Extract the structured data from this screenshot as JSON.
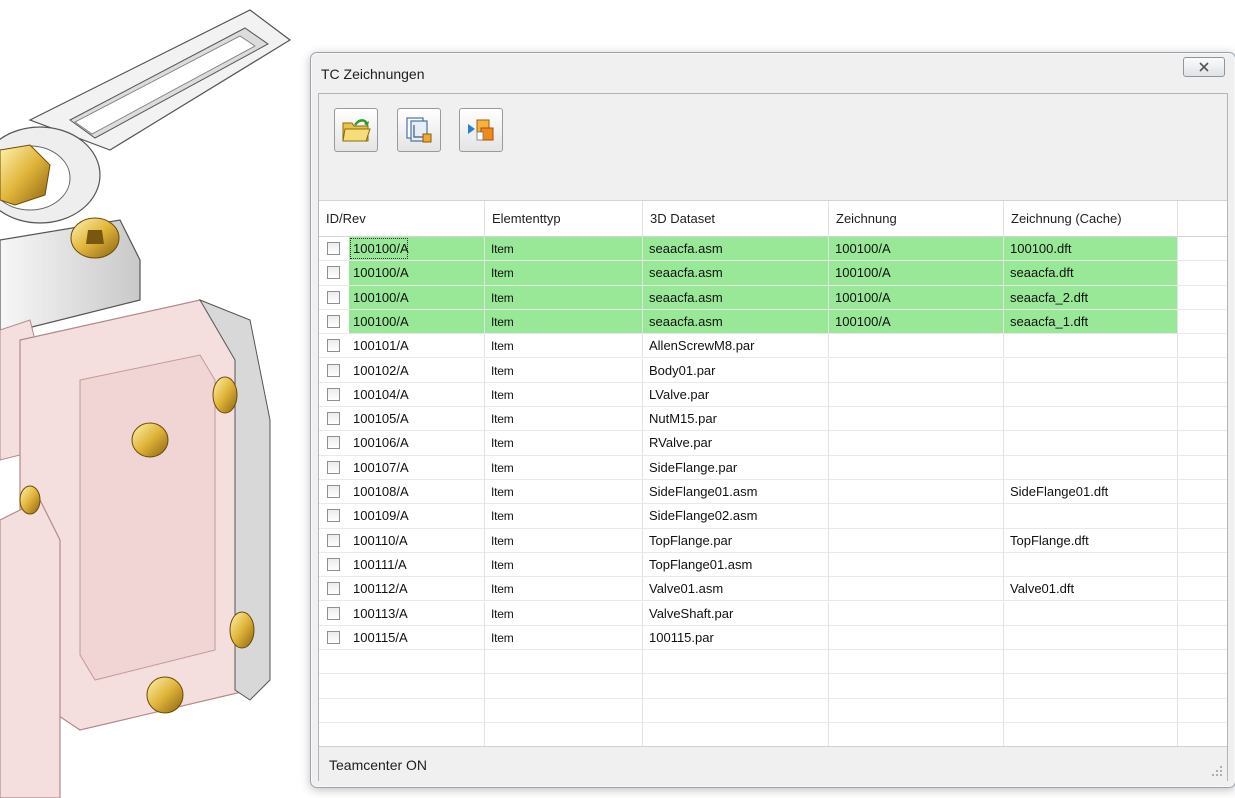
{
  "window": {
    "title": "TC Zeichnungen"
  },
  "toolbar": {
    "buttons": [
      {
        "icon": "open-folder-icon"
      },
      {
        "icon": "drawing-view-icon"
      },
      {
        "icon": "transfer-icon"
      }
    ]
  },
  "table": {
    "columns": [
      "ID/Rev",
      "Elemtenttyp",
      "3D Dataset",
      "Zeichnung",
      "Zeichnung (Cache)"
    ],
    "rows": [
      {
        "id": "100100/A",
        "type": "Item",
        "dataset": "seaacfa.asm",
        "drawing": "100100/A",
        "cache": "100100.dft",
        "highlight": true
      },
      {
        "id": "100100/A",
        "type": "Item",
        "dataset": "seaacfa.asm",
        "drawing": "100100/A",
        "cache": "seaacfa.dft",
        "highlight": true
      },
      {
        "id": "100100/A",
        "type": "Item",
        "dataset": "seaacfa.asm",
        "drawing": "100100/A",
        "cache": "seaacfa_2.dft",
        "highlight": true
      },
      {
        "id": "100100/A",
        "type": "Item",
        "dataset": "seaacfa.asm",
        "drawing": "100100/A",
        "cache": "seaacfa_1.dft",
        "highlight": true
      },
      {
        "id": "100101/A",
        "type": "Item",
        "dataset": "AllenScrewM8.par",
        "drawing": "",
        "cache": ""
      },
      {
        "id": "100102/A",
        "type": "Item",
        "dataset": "Body01.par",
        "drawing": "",
        "cache": ""
      },
      {
        "id": "100104/A",
        "type": "Item",
        "dataset": "LValve.par",
        "drawing": "",
        "cache": ""
      },
      {
        "id": "100105/A",
        "type": "Item",
        "dataset": "NutM15.par",
        "drawing": "",
        "cache": ""
      },
      {
        "id": "100106/A",
        "type": "Item",
        "dataset": "RValve.par",
        "drawing": "",
        "cache": ""
      },
      {
        "id": "100107/A",
        "type": "Item",
        "dataset": "SideFlange.par",
        "drawing": "",
        "cache": ""
      },
      {
        "id": "100108/A",
        "type": "Item",
        "dataset": "SideFlange01.asm",
        "drawing": "",
        "cache": "SideFlange01.dft"
      },
      {
        "id": "100109/A",
        "type": "Item",
        "dataset": "SideFlange02.asm",
        "drawing": "",
        "cache": ""
      },
      {
        "id": "100110/A",
        "type": "Item",
        "dataset": "TopFlange.par",
        "drawing": "",
        "cache": "TopFlange.dft"
      },
      {
        "id": "100111/A",
        "type": "Item",
        "dataset": "TopFlange01.asm",
        "drawing": "",
        "cache": ""
      },
      {
        "id": "100112/A",
        "type": "Item",
        "dataset": "Valve01.asm",
        "drawing": "",
        "cache": "Valve01.dft"
      },
      {
        "id": "100113/A",
        "type": "Item",
        "dataset": "ValveShaft.par",
        "drawing": "",
        "cache": ""
      },
      {
        "id": "100115/A",
        "type": "Item",
        "dataset": "100115.par",
        "drawing": "",
        "cache": ""
      }
    ]
  },
  "status": {
    "text": "Teamcenter ON"
  },
  "colors": {
    "highlight_row": "#98e898",
    "dialog_bg": "#f0f0f0"
  }
}
